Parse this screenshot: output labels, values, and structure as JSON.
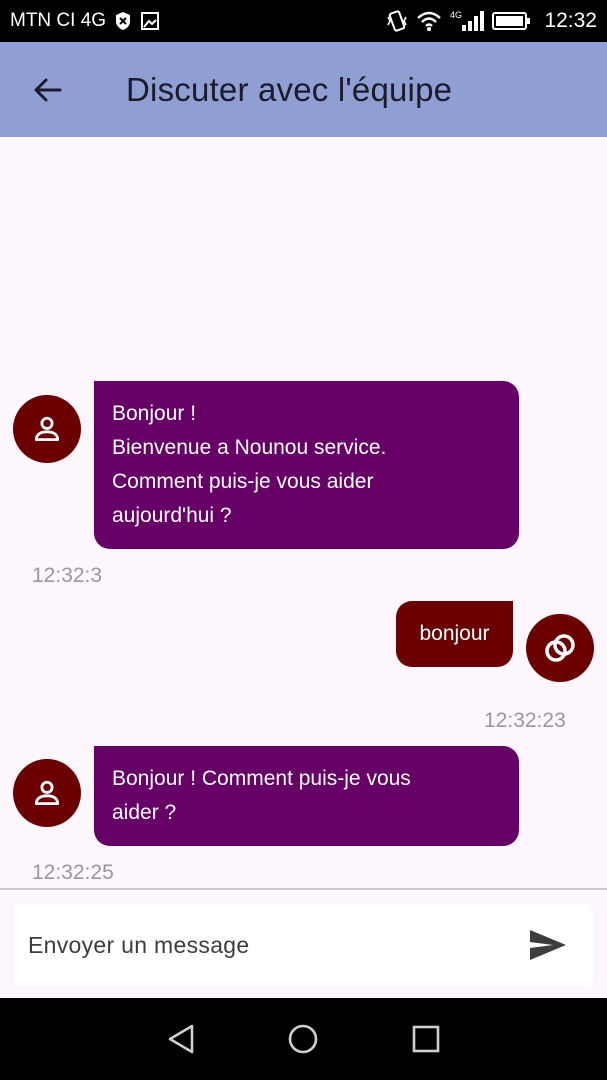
{
  "status_bar": {
    "carrier": "MTN CI 4G",
    "network_type": "4G",
    "time": "12:32",
    "icons": [
      "shield-icon",
      "image-icon",
      "vibrate-icon",
      "wifi-icon",
      "signal-icon",
      "battery-icon"
    ]
  },
  "app_bar": {
    "back_icon": "arrow-back-icon",
    "title": "Discuter avec l'équipe",
    "color": "#8f9fd4"
  },
  "messages": [
    {
      "sender": "bot",
      "avatar_icon": "person-icon",
      "lines": [
        "Bonjour !",
        "Bienvenue a Nounou service.",
        "Comment puis-je vous aider",
        "aujourd'hui ?"
      ],
      "time": "12:32:3"
    },
    {
      "sender": "user",
      "avatar_icon": "rings-icon",
      "lines": [
        "bonjour"
      ],
      "time": "12:32:23"
    },
    {
      "sender": "bot",
      "avatar_icon": "person-icon",
      "lines": [
        "Bonjour ! Comment puis-je vous",
        "aider ?"
      ],
      "time": "12:32:25"
    }
  ],
  "composer": {
    "placeholder": "Envoyer un message",
    "send_icon": "send-icon"
  },
  "nav_bar": {
    "icons": [
      "nav-back-icon",
      "nav-home-icon",
      "nav-recents-icon"
    ]
  },
  "colors": {
    "bot_bubble": "#660066",
    "user_bubble": "#6b0000",
    "avatar": "#6b0000",
    "background": "#fdf6fd",
    "timestamp": "#9a96a0"
  }
}
